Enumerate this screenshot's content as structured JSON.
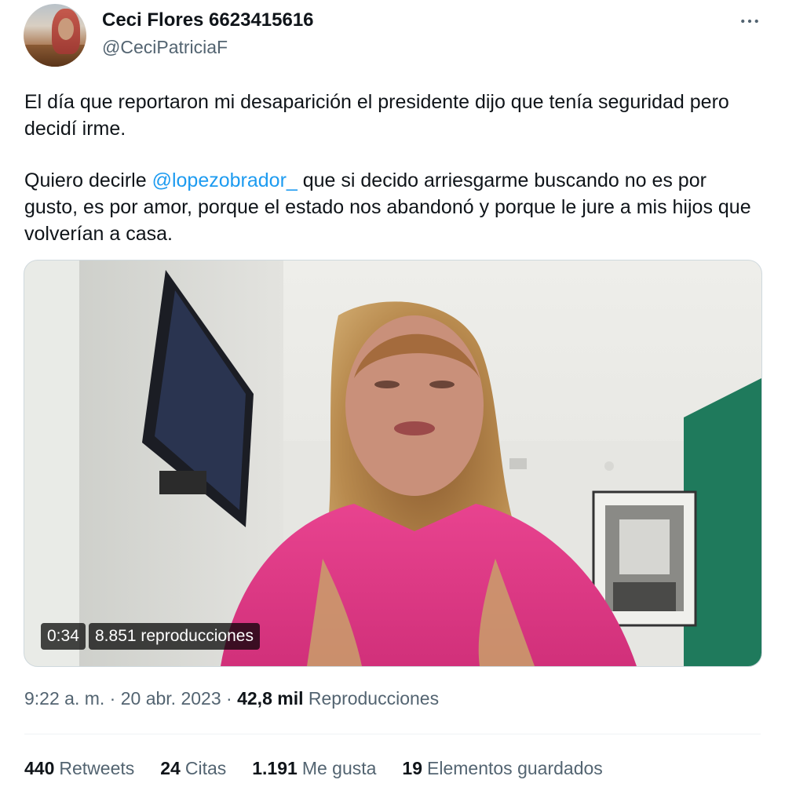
{
  "author": {
    "display_name": "Ceci Flores 6623415616",
    "handle": "@CeciPatriciaF"
  },
  "tweet": {
    "paragraph1": "El día que reportaron mi desaparición el presidente dijo que tenía seguridad pero decidí irme.",
    "paragraph2_before": "Quiero decirle ",
    "mention": "@lopezobrador_",
    "paragraph2_after": " que si decido arriesgarme buscando no es por gusto, es por amor, porque el estado nos abandonó y porque le jure a mis hijos que volverían a casa."
  },
  "media": {
    "type": "video",
    "duration": "0:34",
    "views": "8.851 reproducciones"
  },
  "meta": {
    "time": "9:22 a. m.",
    "separator": "·",
    "date": "20 abr. 2023",
    "views_count": "42,8 mil",
    "views_label": "Reproducciones"
  },
  "stats": [
    {
      "count": "440",
      "label": "Retweets"
    },
    {
      "count": "24",
      "label": "Citas"
    },
    {
      "count": "1.191",
      "label": "Me gusta"
    },
    {
      "count": "19",
      "label": "Elementos guardados"
    }
  ],
  "icons": {
    "more": "more-horizontal-icon"
  },
  "colors": {
    "text": "#0f1419",
    "secondary": "#536471",
    "link": "#1d9bf0",
    "divider": "#eff3f4"
  }
}
